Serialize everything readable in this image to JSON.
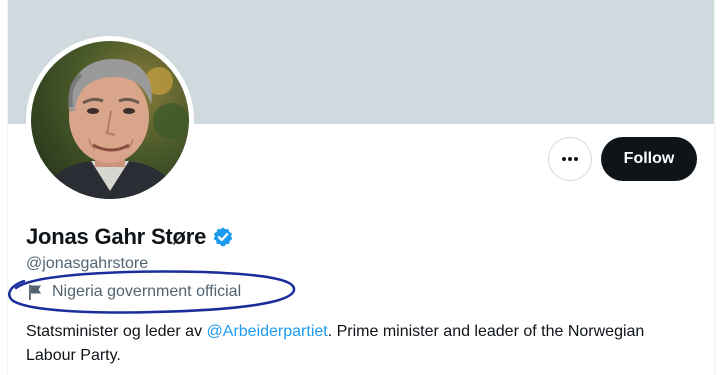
{
  "profile": {
    "display_name": "Jonas Gahr Støre",
    "handle": "@jonasgahrstore",
    "label": "Nigeria government official",
    "bio_part1": "Statsminister og leder av ",
    "bio_mention": "@Arbeiderpartiet",
    "bio_part2": ". Prime minister and leader of the Norwegian Labour Party."
  },
  "actions": {
    "follow_label": "Follow",
    "more_label": "More"
  },
  "icons": {
    "more": "more-icon",
    "verified": "verified-badge-icon",
    "flag": "flag-icon"
  },
  "colors": {
    "banner": "#cfd9de",
    "follow_button": "#0f1419",
    "link": "#1d9bf0",
    "verified": "#1d9bf0",
    "annotation": "#1a2d9c"
  }
}
